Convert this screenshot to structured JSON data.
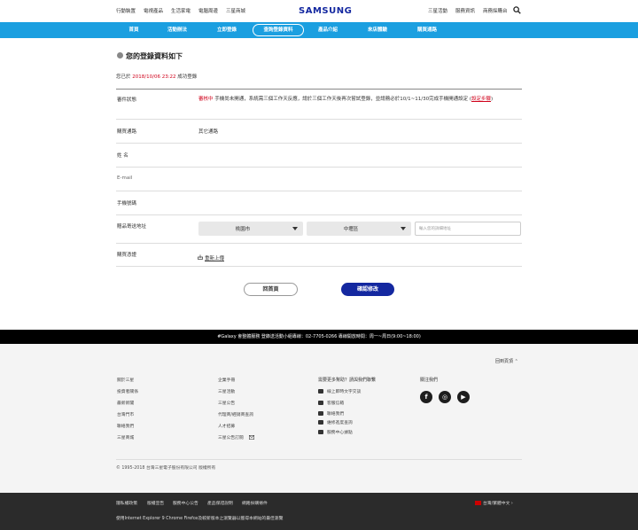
{
  "topbar": {
    "left_links": [
      "行動裝置",
      "電視產品",
      "生活家電",
      "電腦周邊",
      "三星商城"
    ],
    "brand": "SAMSUNG",
    "right_links": [
      "三星活動",
      "服務資訊",
      "商務採購台"
    ]
  },
  "nav": {
    "items": [
      "首頁",
      "活動辦法",
      "立即登錄",
      "查詢登錄資料",
      "產品介紹",
      "來店體驗",
      "購買通路"
    ],
    "active_index": 3
  },
  "page": {
    "title": "您的登錄資料如下",
    "sub_prefix": "您已於 ",
    "sub_date": "2018/10/06 23:22",
    "sub_suffix": " 成功登錄"
  },
  "form": {
    "status_label": "審件狀態",
    "status_red": "審核中",
    "status_text": " 手機尚未開通，系統需三個工作天反應，請於三個工作天後再次嘗試登錄，並請務必於10/1~11/30完成手機開通設定 (",
    "status_link": "設定步驟",
    "status_end": ")",
    "channel_label": "購買通路",
    "channel_value": "其它通路",
    "name_label": "姓 名",
    "email_label": "E-mail",
    "phone_label": "手機號碼",
    "address_label": "贈品寄送地址",
    "city_value": "桃園市",
    "district_value": "中壢區",
    "address_placeholder": "輸入您的詳細地址",
    "receipt_label": "購買憑證",
    "upload_label": "重新上傳"
  },
  "buttons": {
    "back": "回首頁",
    "confirm": "確認修改"
  },
  "blackbar": {
    "text": "#Galaxy 會整體服務 登錄送活動小組專線：02-7705-0266 專線開放時間：周一~周日(9:00~18:00)"
  },
  "footer": {
    "back_to_top": "回到頁頂",
    "col1": [
      "關於三星",
      "投資者關係",
      "最新新聞",
      "台灣門市",
      "聯絡我們",
      "三星商城"
    ],
    "col2": [
      "企業手冊",
      "三星活動",
      "三星公告",
      "代理商/經銷商查詢",
      "人才招募",
      "三星公告訂閱"
    ],
    "help_heading": "需要更多幫助？請與我們聯繫",
    "help_items": [
      "線上即時文字交談",
      "客服信箱",
      "聯絡我們",
      "維修進度查詢",
      "服務中心據點"
    ],
    "follow_heading": "關注我們",
    "social": [
      "f",
      "◎",
      "▶"
    ],
    "copyright": "© 1995-2018 台灣三星電子股份有限公司 版權所有"
  },
  "bottombar": {
    "links": [
      "隱私權政策",
      "版權宣告",
      "服務中心公告",
      "產品保證說明",
      "網路採購條件"
    ],
    "region": "台灣/繁體中文",
    "note": "使用Internet Explorer 9 Chrome Firefox及較新版本之瀏覽器以獲得本網站的最佳瀏覽"
  }
}
